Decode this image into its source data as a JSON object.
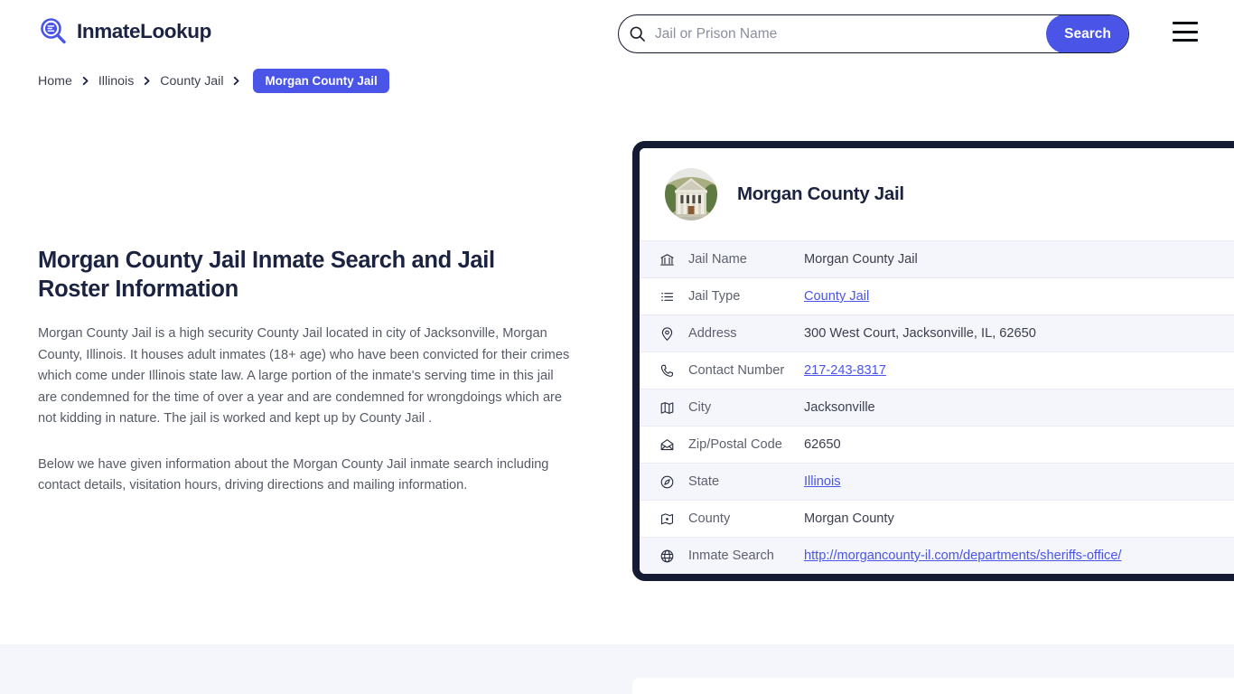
{
  "header": {
    "brand_name": "InmateLookup",
    "brand_icon": "magnifier-list-icon",
    "search": {
      "placeholder": "Jail or Prison Name",
      "value": "",
      "icon": "search-icon",
      "button_label": "Search"
    },
    "menu_icon": "hamburger-menu-icon"
  },
  "breadcrumb": {
    "items": [
      {
        "label": "Home",
        "current": false
      },
      {
        "label": "Illinois",
        "current": false
      },
      {
        "label": "County Jail",
        "current": false
      },
      {
        "label": "Morgan County Jail",
        "current": true
      }
    ],
    "separator_icon": "chevron-right-icon"
  },
  "main": {
    "page_title": "Morgan County Jail Inmate Search and Jail Roster Information",
    "paragraph_1": "Morgan County Jail is a high security County Jail located in city of Jacksonville, Morgan County, Illinois. It houses adult inmates (18+ age) who have been convicted for their crimes which come under Illinois state law. A large portion of the inmate's serving time in this jail are condemned for the time of over a year and are condemned for wrongdoings which are not kidding in nature. The jail is worked and kept up by County Jail .",
    "paragraph_2": "Below we have given information about the Morgan County Jail inmate search including contact details, visitation hours, driving directions and mailing information."
  },
  "info_card": {
    "avatar_icon": "courthouse-photo",
    "title": "Morgan County Jail",
    "rows": [
      {
        "icon": "bank-icon",
        "label": "Jail Name",
        "value": "Morgan County Jail",
        "is_link": false
      },
      {
        "icon": "list-icon",
        "label": "Jail Type",
        "value": "County Jail",
        "is_link": true
      },
      {
        "icon": "map-pin-icon",
        "label": "Address",
        "value": "300 West Court, Jacksonville, IL, 62650",
        "is_link": false
      },
      {
        "icon": "phone-icon",
        "label": "Contact Number",
        "value": "217-243-8317",
        "is_link": true
      },
      {
        "icon": "map-icon",
        "label": "City",
        "value": "Jacksonville",
        "is_link": false
      },
      {
        "icon": "envelope-icon",
        "label": "Zip/Postal Code",
        "value": "62650",
        "is_link": false
      },
      {
        "icon": "compass-icon",
        "label": "State",
        "value": "Illinois",
        "is_link": true
      },
      {
        "icon": "county-icon",
        "label": "County",
        "value": "Morgan County",
        "is_link": false
      },
      {
        "icon": "globe-icon",
        "label": "Inmate Search",
        "value": "http://morgancounty-il.com/departments/sheriffs-office/",
        "is_link": true
      }
    ]
  },
  "colors": {
    "accent": "#4a55e8",
    "ink": "#1b2341",
    "card_border": "#141b32",
    "row_alt": "#f5f5fc"
  }
}
